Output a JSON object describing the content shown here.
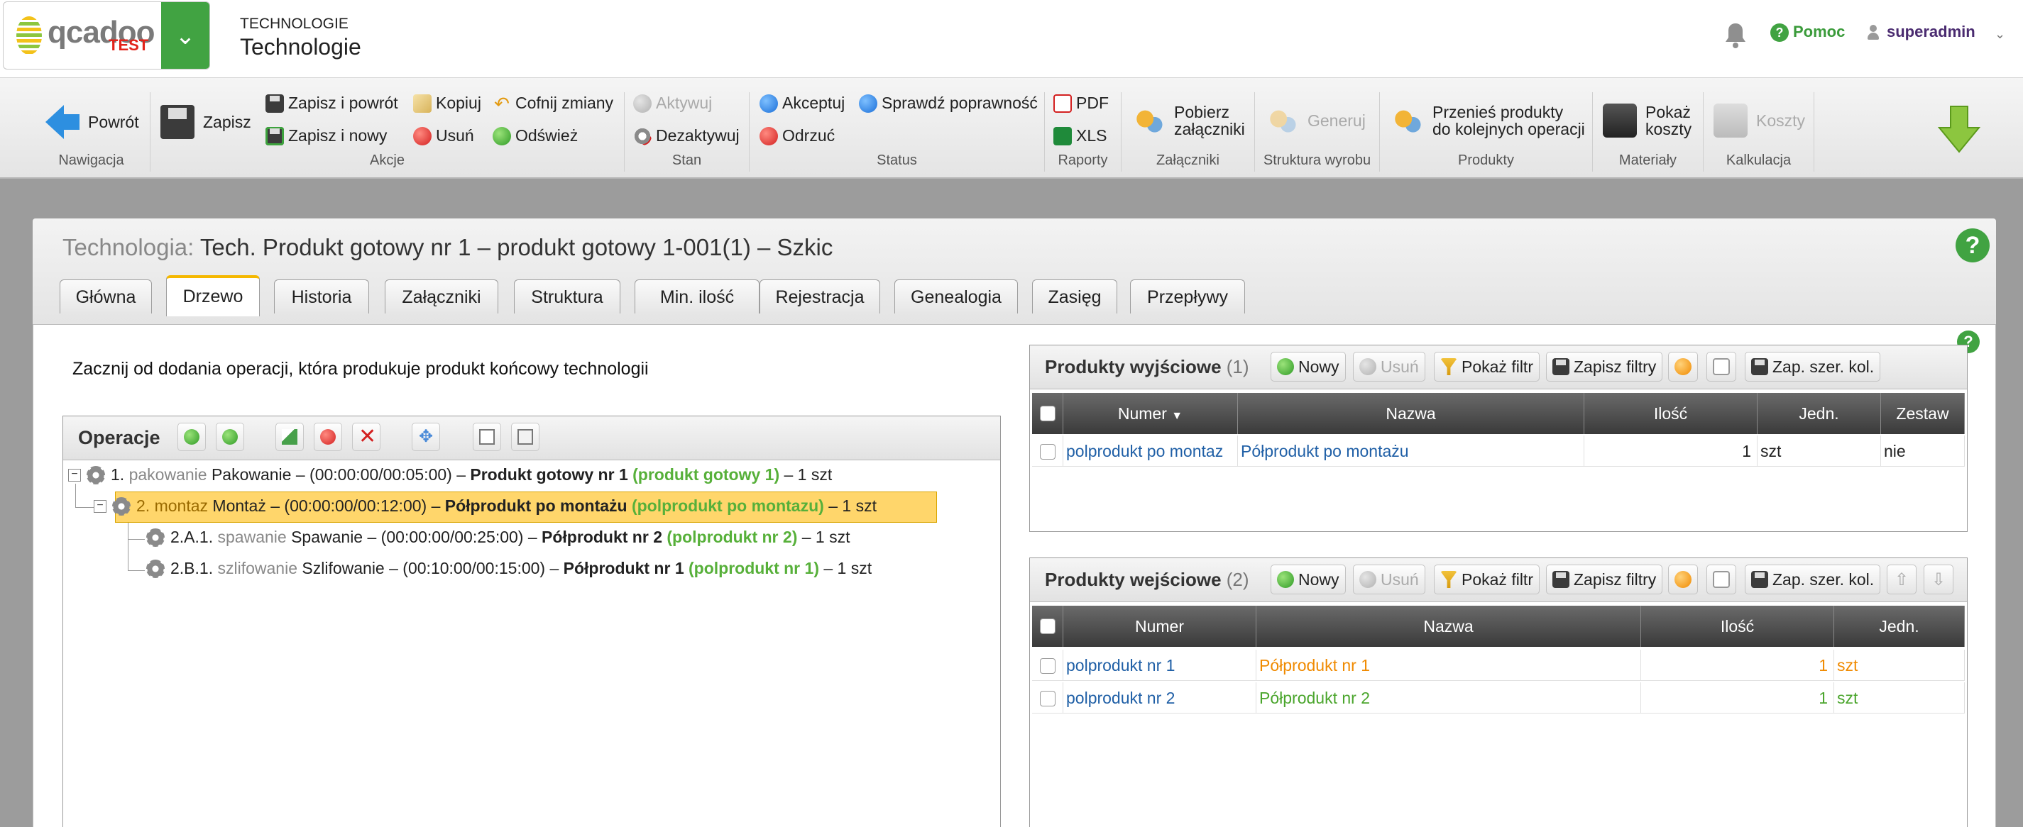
{
  "header": {
    "logo_text": "qcadoo",
    "logo_badge": "TEST",
    "breadcrumb_small": "TECHNOLOGIE",
    "breadcrumb_big": "Technologie",
    "help_label": "Pomoc",
    "user_name": "superadmin"
  },
  "ribbon": {
    "groups": {
      "nawigacja": "Nawigacja",
      "akcje": "Akcje",
      "stan": "Stan",
      "status": "Status",
      "raporty": "Raporty",
      "zalaczniki": "Załączniki",
      "struktura": "Struktura wyrobu",
      "produkty": "Produkty",
      "materialy": "Materiały",
      "kalkulacja": "Kalkulacja"
    },
    "buttons": {
      "powrot": "Powrót",
      "zapisz": "Zapisz",
      "zapisz_i_powrot": "Zapisz i powrót",
      "zapisz_i_nowy": "Zapisz i nowy",
      "kopiuj": "Kopiuj",
      "usun": "Usuń",
      "cofnij_zmiany": "Cofnij zmiany",
      "odswiez": "Odśwież",
      "aktywuj": "Aktywuj",
      "dezaktywuj": "Dezaktywuj",
      "akceptuj": "Akceptuj",
      "odrzuc": "Odrzuć",
      "sprawdz": "Sprawdź poprawność",
      "pdf": "PDF",
      "xls": "XLS",
      "pobierz_1": "Pobierz",
      "pobierz_2": "załączniki",
      "generuj": "Generuj",
      "przenies_1": "Przenieś produkty",
      "przenies_2": "do kolejnych operacji",
      "pokaz_1": "Pokaż",
      "pokaz_2": "koszty",
      "koszty": "Koszty"
    }
  },
  "page": {
    "title_prefix": "Technologia:",
    "title": "Tech. Produkt gotowy nr 1 – produkt gotowy 1-001(1) – Szkic",
    "tabs": [
      "Główna",
      "Drzewo",
      "Historia",
      "Załączniki",
      "Struktura",
      "Min. ilość",
      "Rejestracja",
      "Genealogia",
      "Zasięg",
      "Przepływy"
    ],
    "active_tab": "Drzewo",
    "intro": "Zacznij od dodania operacji, która produkuje produkt końcowy technologii"
  },
  "operations": {
    "title": "Operacje",
    "tree": [
      {
        "num": "1.",
        "code": "pakowanie",
        "name": "Pakowanie",
        "times": "– (00:00:00/00:05:00) –",
        "product": "Produkt gotowy nr 1",
        "product_code": "(produkt gotowy 1)",
        "qty": "– 1 szt"
      },
      {
        "num": "2.",
        "code": "montaz",
        "name": "Montaż",
        "times": "– (00:00:00/00:12:00) –",
        "product": "Półprodukt po montażu",
        "product_code": "(polprodukt po montazu)",
        "qty": "– 1 szt"
      },
      {
        "num": "2.A.1.",
        "code": "spawanie",
        "name": "Spawanie",
        "times": "– (00:00:00/00:25:00) –",
        "product": "Półprodukt nr 2",
        "product_code": "(polprodukt nr 2)",
        "qty": "– 1 szt"
      },
      {
        "num": "2.B.1.",
        "code": "szlifowanie",
        "name": "Szlifowanie",
        "times": "– (00:10:00/00:15:00) –",
        "product": "Półprodukt nr 1",
        "product_code": "(polprodukt nr 1)",
        "qty": "– 1 szt"
      }
    ]
  },
  "grid_buttons": {
    "nowy": "Nowy",
    "usun": "Usuń",
    "pokaz_filtr": "Pokaż filtr",
    "zapisz_filtry": "Zapisz filtry",
    "zap_szer_kol": "Zap. szer. kol."
  },
  "output_products": {
    "title": "Produkty wyjściowe",
    "count": "(1)",
    "columns": [
      "Numer",
      "Nazwa",
      "Ilość",
      "Jedn.",
      "Zestaw"
    ],
    "rows": [
      {
        "numer": "polprodukt po montaz",
        "nazwa": "Półprodukt po montażu",
        "ilosc": "1",
        "jedn": "szt",
        "zestaw": "nie"
      }
    ]
  },
  "input_products": {
    "title": "Produkty wejściowe",
    "count": "(2)",
    "columns": [
      "Numer",
      "Nazwa",
      "Ilość",
      "Jedn."
    ],
    "rows": [
      {
        "numer": "polprodukt nr 1",
        "nazwa": "Półprodukt nr 1",
        "ilosc": "1",
        "jedn": "szt"
      },
      {
        "numer": "polprodukt nr 2",
        "nazwa": "Półprodukt nr 2",
        "ilosc": "1",
        "jedn": "szt"
      }
    ]
  },
  "colors": {
    "accent_green": "#41a342",
    "tab_accent": "#f5b800",
    "selection": "#ffd66b",
    "link": "#1f5fa6",
    "orange_row": "#f08a00",
    "green_row": "#4aa52c"
  }
}
